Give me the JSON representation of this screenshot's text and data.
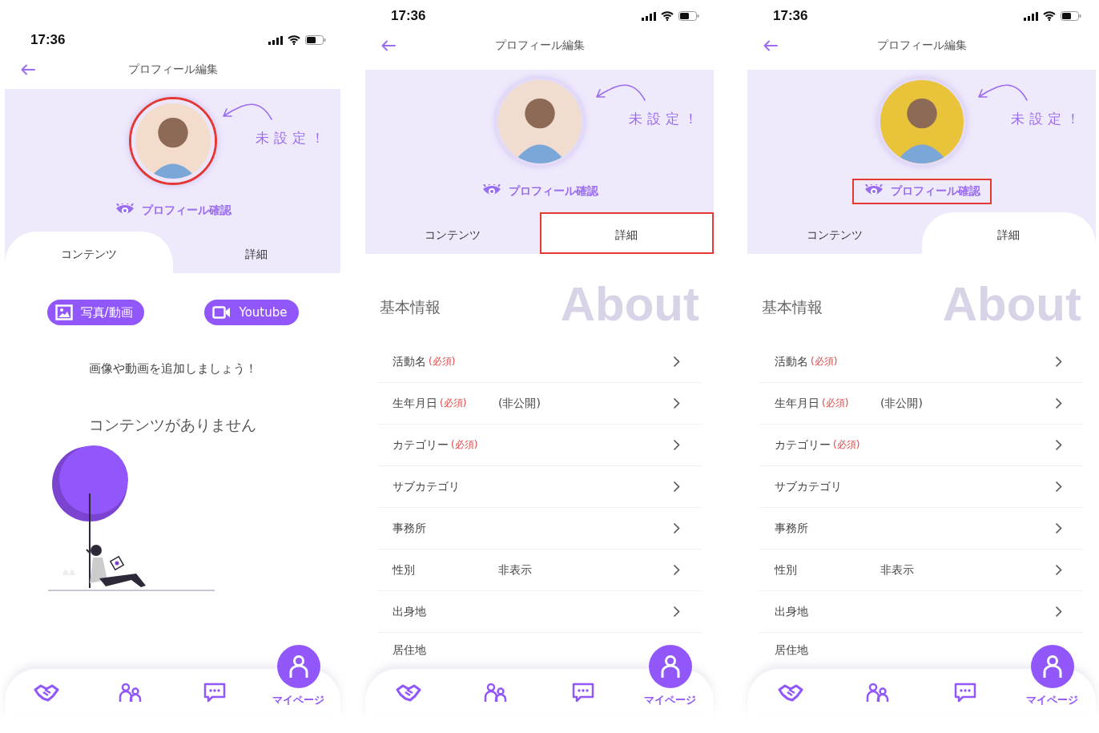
{
  "phones": [
    {
      "time": "17:36",
      "title": "プロフィール編集",
      "note": "未設定！",
      "avatar": {
        "highlighted": true
      },
      "confirm_link": {
        "label": "プロフィール確認",
        "highlighted": false
      },
      "tabs": [
        {
          "label": "コンテンツ",
          "selected": true,
          "highlighted": false
        },
        {
          "label": "詳細",
          "selected": false,
          "highlighted": false
        }
      ],
      "content": {
        "kind": "media",
        "buttons": [
          {
            "label": "写真/動画"
          },
          {
            "label": "Youtube"
          }
        ],
        "hint": "画像や動画を追加しましょう！",
        "empty": "コンテンツがありません"
      },
      "nav": [
        {
          "selected": false
        },
        {
          "selected": false
        },
        {
          "selected": false
        },
        {
          "label": "マイページ",
          "selected": true
        }
      ]
    },
    {
      "time": "17:36",
      "title": "プロフィール編集",
      "note": "未設定！",
      "avatar": {
        "highlighted": false
      },
      "confirm_link": {
        "label": "プロフィール確認",
        "highlighted": false
      },
      "tabs": [
        {
          "label": "コンテンツ",
          "selected": false,
          "highlighted": false
        },
        {
          "label": "詳細",
          "selected": true,
          "highlighted": true
        }
      ],
      "content": {
        "kind": "details",
        "heading": "基本情報",
        "backdrop": "About",
        "rows": [
          {
            "label": "活動名",
            "required": "(必須)"
          },
          {
            "label": "生年月日",
            "required": "(必須)",
            "value": "(非公開)"
          },
          {
            "label": "カテゴリー",
            "required": "(必須)"
          },
          {
            "label": "サブカテゴリ"
          },
          {
            "label": "事務所"
          },
          {
            "label": "性別",
            "value": "非表示"
          },
          {
            "label": "出身地"
          },
          {
            "label": "居住地"
          }
        ]
      },
      "nav": [
        {
          "selected": false
        },
        {
          "selected": false
        },
        {
          "selected": false
        },
        {
          "label": "マイページ",
          "selected": true
        }
      ]
    },
    {
      "time": "17:36",
      "title": "プロフィール編集",
      "note": "未設定！",
      "avatar": {
        "highlighted": false
      },
      "confirm_link": {
        "label": "プロフィール確認",
        "highlighted": true
      },
      "tabs": [
        {
          "label": "コンテンツ",
          "selected": false,
          "highlighted": false
        },
        {
          "label": "詳細",
          "selected": true,
          "highlighted": false
        }
      ],
      "content": {
        "kind": "details",
        "heading": "基本情報",
        "backdrop": "About",
        "rows": [
          {
            "label": "活動名",
            "required": "(必須)"
          },
          {
            "label": "生年月日",
            "required": "(必須)",
            "value": "(非公開)"
          },
          {
            "label": "カテゴリー",
            "required": "(必須)"
          },
          {
            "label": "サブカテゴリ"
          },
          {
            "label": "事務所"
          },
          {
            "label": "性別",
            "value": "非表示"
          },
          {
            "label": "出身地"
          },
          {
            "label": "居住地"
          }
        ]
      },
      "nav": [
        {
          "selected": false
        },
        {
          "selected": false
        },
        {
          "selected": false
        },
        {
          "label": "マイページ",
          "selected": true
        }
      ]
    }
  ]
}
